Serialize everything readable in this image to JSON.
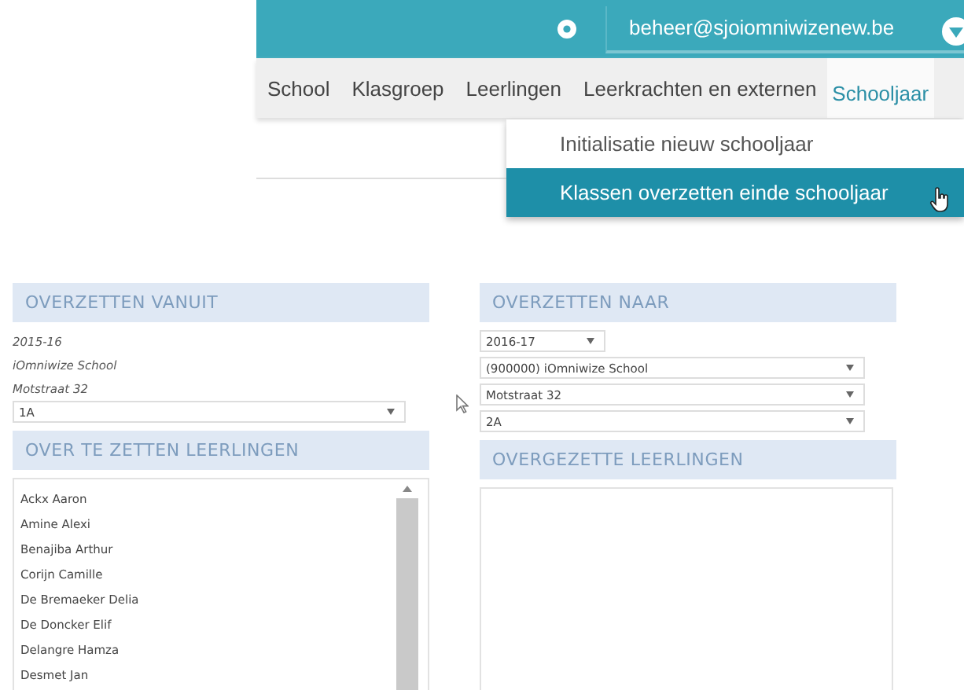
{
  "header": {
    "user": "beheer@sjoiomniwizenew.be"
  },
  "tabs": [
    {
      "label": "School",
      "selected": false
    },
    {
      "label": "Klasgroep",
      "selected": false
    },
    {
      "label": "Leerlingen",
      "selected": false
    },
    {
      "label": "Leerkrachten en externen",
      "selected": false
    },
    {
      "label": "Schooljaar",
      "selected": true
    }
  ],
  "menu": [
    {
      "label": "Initialisatie nieuw schooljaar",
      "selected": false
    },
    {
      "label": "Klassen overzetten einde schooljaar",
      "selected": true
    }
  ],
  "source": {
    "title": "OVERZETTEN VANUIT",
    "info": [
      "2015-16",
      "iOmniwize School",
      "Motstraat 32"
    ],
    "class": "1A",
    "list_title": "OVER TE ZETTEN LEERLINGEN",
    "students": [
      "Ackx Aaron",
      "Amine Alexi",
      "Benajiba Arthur",
      "Corijn Camille",
      "De Bremaeker Delia",
      "De Doncker Elif",
      "Delangre Hamza",
      "Desmet Jan"
    ]
  },
  "target": {
    "title": "OVERZETTEN NAAR",
    "selects": [
      {
        "value": "2016-17",
        "kind": "short"
      },
      {
        "value": "(900000) iOmniwize School",
        "kind": "wide"
      },
      {
        "value": "Motstraat 32",
        "kind": "wide"
      },
      {
        "value": "2A",
        "kind": "wide"
      }
    ],
    "list_title": "OVERGEZETTE LEERLINGEN"
  }
}
